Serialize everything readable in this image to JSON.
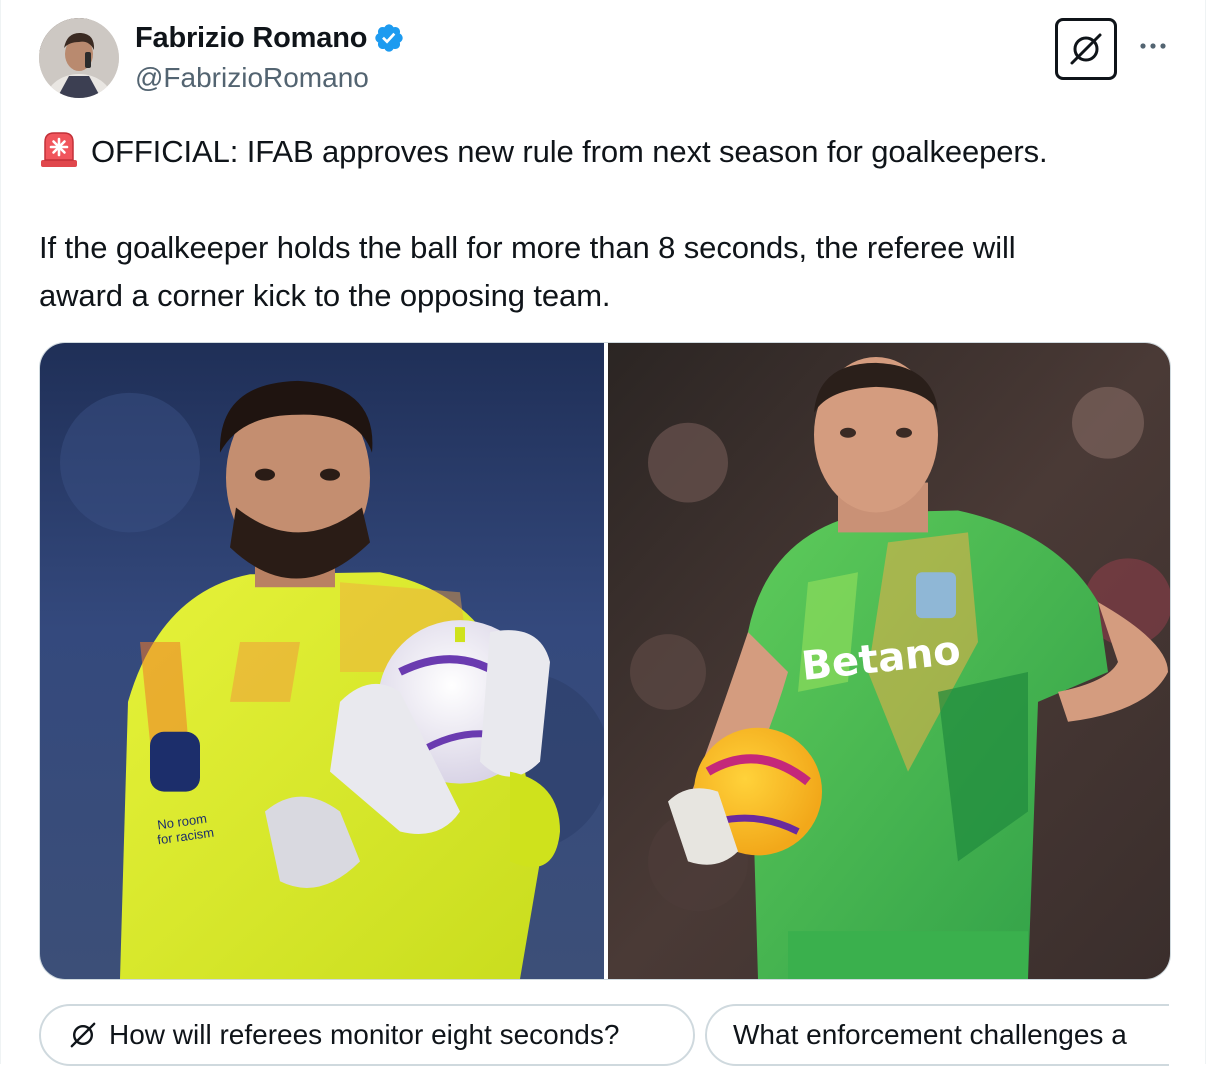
{
  "author": {
    "display_name": "Fabrizio Romano",
    "handle": "@FabrizioRomano",
    "verified": true
  },
  "header_icons": [
    "avatar",
    "verified-badge-icon",
    "grok-icon",
    "more-icon"
  ],
  "tweet": {
    "line1": "OFFICIAL: IFAB approves new rule from next season for goalkeepers.",
    "line2": "If the goalkeeper holds the ball for more than 8 seconds, the referee will",
    "line3": "award a corner kick to the opposing team.",
    "leading_emoji": "siren-icon"
  },
  "media": {
    "left_photo_caption_glyphs": "No room for racism",
    "right_photo_sponsor": "Betano"
  },
  "suggestions": [
    {
      "icon": "grok-icon",
      "label": "How will referees monitor eight seconds?"
    },
    {
      "label": "What enforcement challenges a"
    }
  ],
  "colors": {
    "text": "#0f1419",
    "secondary": "#536471",
    "verified": "#1d9bf0",
    "border": "#cfd9de"
  }
}
